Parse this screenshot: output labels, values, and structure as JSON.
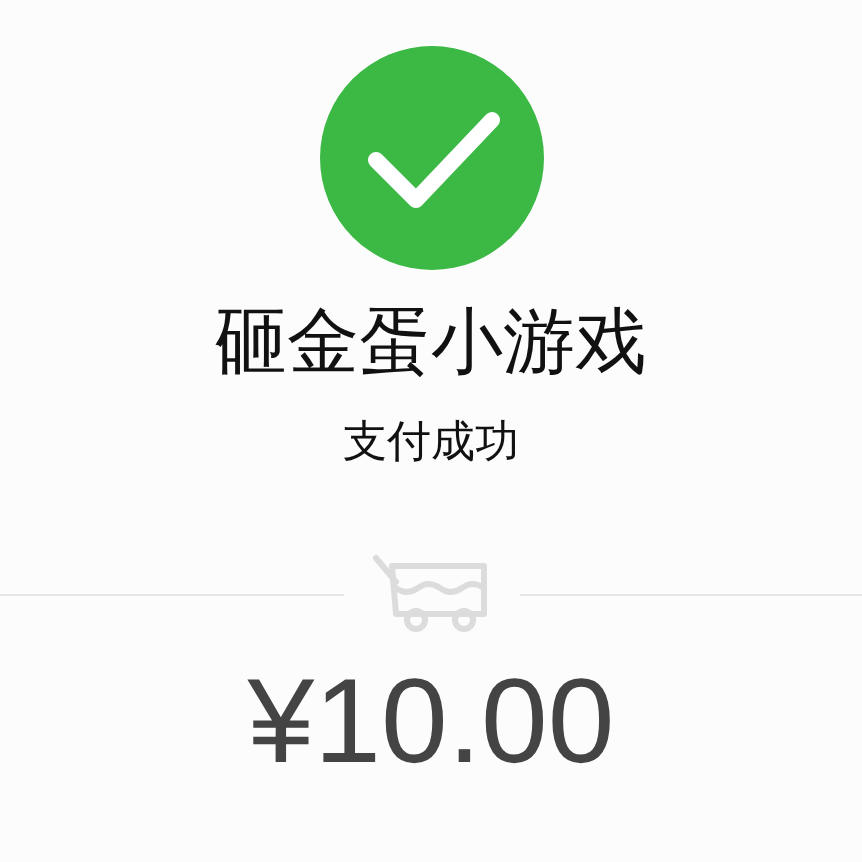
{
  "merchant": {
    "name": "砸金蛋小游戏"
  },
  "status": {
    "text": "支付成功"
  },
  "amount": {
    "value": "¥10.00"
  }
}
